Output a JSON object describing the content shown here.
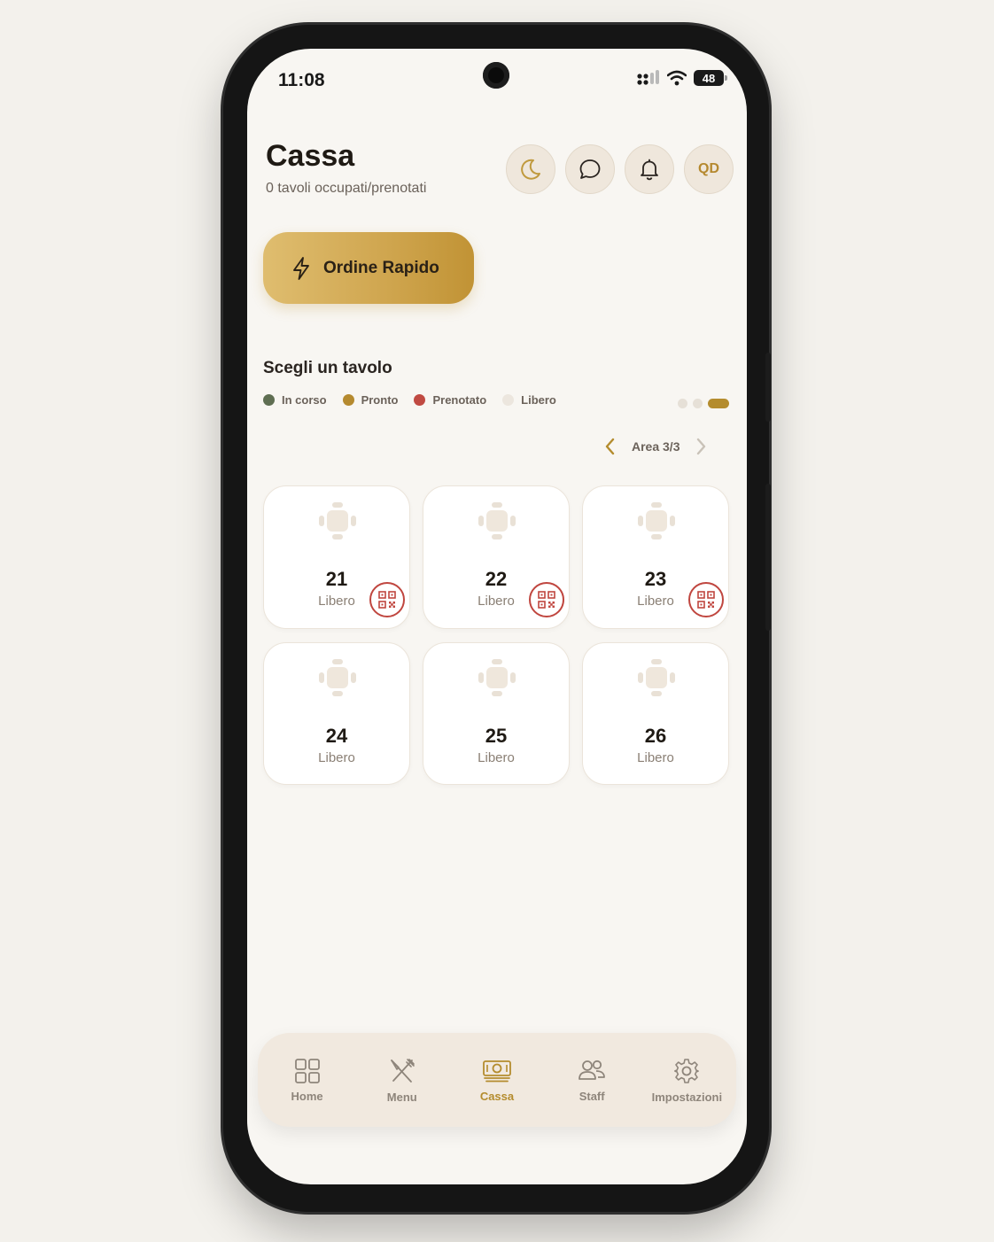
{
  "status_bar": {
    "time": "11:08",
    "battery": "48"
  },
  "header": {
    "title": "Cassa",
    "subtitle": "0 tavoli occupati/prenotati",
    "buttons": [
      {
        "icon": "moon-icon"
      },
      {
        "icon": "chat-icon"
      },
      {
        "icon": "bell-icon"
      },
      {
        "icon": "avatar",
        "label": "QD"
      }
    ]
  },
  "quick_order": {
    "label": "Ordine Rapido",
    "icon": "lightning-icon"
  },
  "tables_section": {
    "title": "Scegli un tavolo",
    "legend": [
      {
        "label": "In corso",
        "color": "#5f6e52"
      },
      {
        "label": "Pronto",
        "color": "#b58a2f"
      },
      {
        "label": "Prenotato",
        "color": "#c04a42"
      },
      {
        "label": "Libero",
        "color": "#ece6de"
      }
    ],
    "page_indicator": {
      "pages": 3,
      "active": 3
    },
    "area_label": "Area 3/3",
    "tables": [
      {
        "number": "21",
        "status": "Libero",
        "qr": true
      },
      {
        "number": "22",
        "status": "Libero",
        "qr": true
      },
      {
        "number": "23",
        "status": "Libero",
        "qr": true
      },
      {
        "number": "24",
        "status": "Libero",
        "qr": false
      },
      {
        "number": "25",
        "status": "Libero",
        "qr": false
      },
      {
        "number": "26",
        "status": "Libero",
        "qr": false
      }
    ]
  },
  "bottom_nav": {
    "items": [
      {
        "label": "Home",
        "icon": "grid-icon"
      },
      {
        "label": "Menu",
        "icon": "utensils-icon"
      },
      {
        "label": "Cassa",
        "icon": "cash-icon",
        "active": true
      },
      {
        "label": "Staff",
        "icon": "users-icon"
      },
      {
        "label": "Impostazioni",
        "icon": "gear-icon"
      }
    ]
  },
  "colors": {
    "accent": "#b48c2e",
    "qr_red": "#c0463f",
    "background": "#f8f6f2"
  }
}
